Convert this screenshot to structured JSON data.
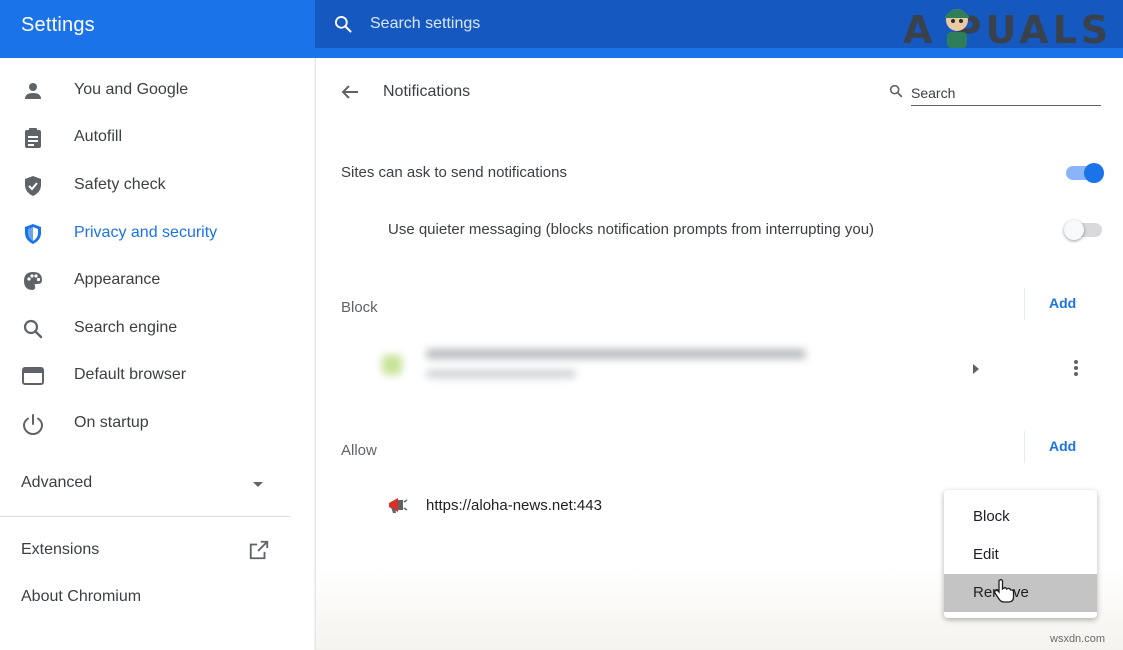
{
  "header": {
    "title": "Settings",
    "search_placeholder": "Search settings",
    "watermark": "A PUALS"
  },
  "sidebar": {
    "items": [
      {
        "label": "You and Google",
        "icon": "person-icon"
      },
      {
        "label": "Autofill",
        "icon": "clipboard-icon"
      },
      {
        "label": "Safety check",
        "icon": "shield-check-icon"
      },
      {
        "label": "Privacy and security",
        "icon": "privacy-shield-icon",
        "active": true
      },
      {
        "label": "Appearance",
        "icon": "palette-icon"
      },
      {
        "label": "Search engine",
        "icon": "search-icon"
      },
      {
        "label": "Default browser",
        "icon": "browser-window-icon"
      },
      {
        "label": "On startup",
        "icon": "power-icon"
      }
    ],
    "advanced_label": "Advanced",
    "extensions_label": "Extensions",
    "about_label": "About Chromium"
  },
  "main": {
    "page_title": "Notifications",
    "search_placeholder": "Search",
    "sites_can_ask_label": "Sites can ask to send notifications",
    "sites_can_ask_enabled": true,
    "quieter_label": "Use quieter messaging (blocks notification prompts from interrupting you)",
    "quieter_enabled": false,
    "block_label": "Block",
    "allow_label": "Allow",
    "add_label": "Add",
    "allowed_site_url": "https://aloha-news.net:443"
  },
  "context_menu": {
    "items": [
      "Block",
      "Edit",
      "Remove"
    ],
    "hovered": "Remove"
  },
  "footer": {
    "site_watermark": "wsxdn.com"
  },
  "colors": {
    "accent": "#1a73e8",
    "header_bg": "#1a73e8",
    "search_bg": "#1558c0"
  }
}
